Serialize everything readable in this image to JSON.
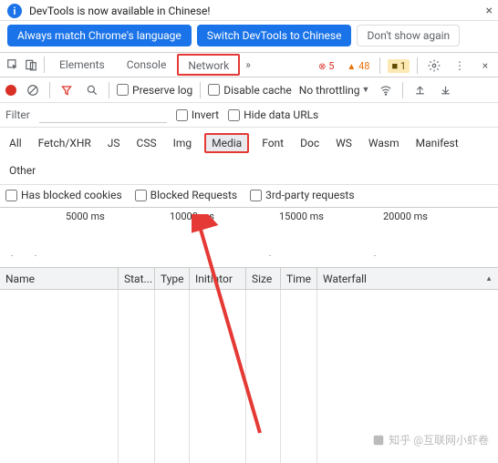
{
  "infobar": {
    "title": "DevTools is now available in Chinese!",
    "btn_match": "Always match Chrome's language",
    "btn_switch": "Switch DevTools to Chinese",
    "btn_dismiss": "Don't show again"
  },
  "tabs": {
    "elements": "Elements",
    "console": "Console",
    "network": "Network",
    "more_glyph": "»"
  },
  "counters": {
    "errors": "5",
    "warnings": "48",
    "issues": "1"
  },
  "toolbar": {
    "preserve_log": "Preserve log",
    "disable_cache": "Disable cache",
    "throttling": "No throttling"
  },
  "filter": {
    "label": "Filter",
    "invert": "Invert",
    "hide_data": "Hide data URLs"
  },
  "types": {
    "all": "All",
    "fetch": "Fetch/XHR",
    "js": "JS",
    "css": "CSS",
    "img": "Img",
    "media": "Media",
    "font": "Font",
    "doc": "Doc",
    "ws": "WS",
    "wasm": "Wasm",
    "manifest": "Manifest",
    "other": "Other"
  },
  "extra": {
    "blocked_cookies": "Has blocked cookies",
    "blocked_requests": "Blocked Requests",
    "third_party": "3rd-party requests"
  },
  "timeline": {
    "t1": "5000 ms",
    "t2": "10000 ms",
    "t3": "15000 ms",
    "t4": "20000 ms"
  },
  "columns": {
    "name": "Name",
    "status": "Stat...",
    "type": "Type",
    "initiator": "Initiator",
    "size": "Size",
    "time": "Time",
    "waterfall": "Waterfall"
  },
  "watermark": "知乎 @互联网小虾卷"
}
